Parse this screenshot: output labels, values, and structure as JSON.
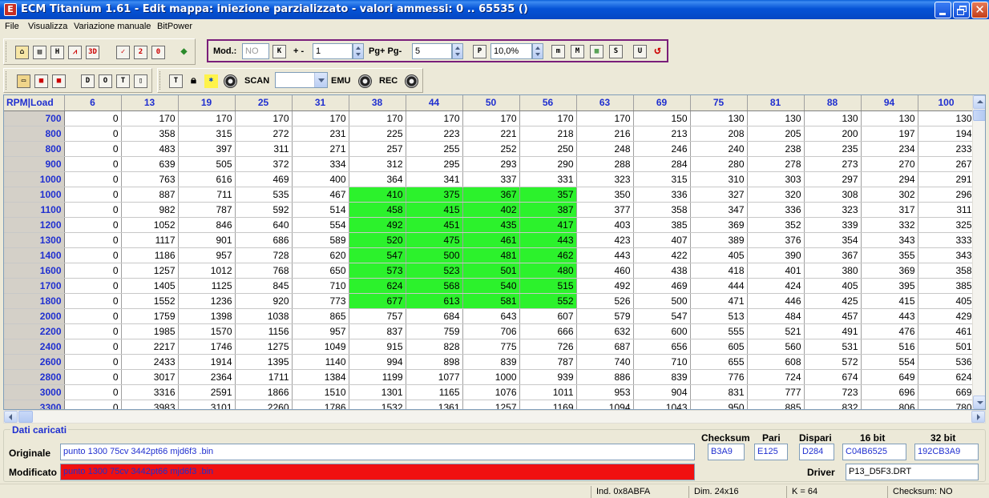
{
  "window": {
    "title": "ECM Titanium 1.61 - Edit mappa: iniezione parzializzato - valori ammessi: 0 .. 65535 ()"
  },
  "menu": [
    "File",
    "Visualizza",
    "Variazione manuale",
    "BitPower"
  ],
  "toolbar": {
    "mod_label": "Mod.:",
    "mod_value": "NO",
    "plusminus_label": "+ -",
    "step_value": "1",
    "page_label": "Pg+ Pg-",
    "page_value": "5",
    "percent_value": "10,0%",
    "scan_label": "SCAN",
    "scan_value": "",
    "emu_label": "EMU",
    "rec_label": "REC"
  },
  "map": {
    "corner": "RPM|Load",
    "columns": [
      "6",
      "13",
      "19",
      "25",
      "31",
      "38",
      "44",
      "50",
      "56",
      "63",
      "69",
      "75",
      "81",
      "88",
      "94",
      "100"
    ],
    "rows": [
      {
        "rpm": "700",
        "values": [
          "0",
          "170",
          "170",
          "170",
          "170",
          "170",
          "170",
          "170",
          "170",
          "170",
          "150",
          "130",
          "130",
          "130",
          "130",
          "130"
        ]
      },
      {
        "rpm": "800",
        "values": [
          "0",
          "358",
          "315",
          "272",
          "231",
          "225",
          "223",
          "221",
          "218",
          "216",
          "213",
          "208",
          "205",
          "200",
          "197",
          "194"
        ]
      },
      {
        "rpm": "800",
        "values": [
          "0",
          "483",
          "397",
          "311",
          "271",
          "257",
          "255",
          "252",
          "250",
          "248",
          "246",
          "240",
          "238",
          "235",
          "234",
          "233"
        ]
      },
      {
        "rpm": "900",
        "values": [
          "0",
          "639",
          "505",
          "372",
          "334",
          "312",
          "295",
          "293",
          "290",
          "288",
          "284",
          "280",
          "278",
          "273",
          "270",
          "267"
        ]
      },
      {
        "rpm": "1000",
        "values": [
          "0",
          "763",
          "616",
          "469",
          "400",
          "364",
          "341",
          "337",
          "331",
          "323",
          "315",
          "310",
          "303",
          "297",
          "294",
          "291"
        ]
      },
      {
        "rpm": "1000",
        "values": [
          "0",
          "887",
          "711",
          "535",
          "467",
          "410",
          "375",
          "367",
          "357",
          "350",
          "336",
          "327",
          "320",
          "308",
          "302",
          "296"
        ]
      },
      {
        "rpm": "1100",
        "values": [
          "0",
          "982",
          "787",
          "592",
          "514",
          "458",
          "415",
          "402",
          "387",
          "377",
          "358",
          "347",
          "336",
          "323",
          "317",
          "311"
        ]
      },
      {
        "rpm": "1200",
        "values": [
          "0",
          "1052",
          "846",
          "640",
          "554",
          "492",
          "451",
          "435",
          "417",
          "403",
          "385",
          "369",
          "352",
          "339",
          "332",
          "325"
        ]
      },
      {
        "rpm": "1300",
        "values": [
          "0",
          "1117",
          "901",
          "686",
          "589",
          "520",
          "475",
          "461",
          "443",
          "423",
          "407",
          "389",
          "376",
          "354",
          "343",
          "333"
        ]
      },
      {
        "rpm": "1400",
        "values": [
          "0",
          "1186",
          "957",
          "728",
          "620",
          "547",
          "500",
          "481",
          "462",
          "443",
          "422",
          "405",
          "390",
          "367",
          "355",
          "343"
        ]
      },
      {
        "rpm": "1600",
        "values": [
          "0",
          "1257",
          "1012",
          "768",
          "650",
          "573",
          "523",
          "501",
          "480",
          "460",
          "438",
          "418",
          "401",
          "380",
          "369",
          "358"
        ]
      },
      {
        "rpm": "1700",
        "values": [
          "0",
          "1405",
          "1125",
          "845",
          "710",
          "624",
          "568",
          "540",
          "515",
          "492",
          "469",
          "444",
          "424",
          "405",
          "395",
          "385"
        ]
      },
      {
        "rpm": "1800",
        "values": [
          "0",
          "1552",
          "1236",
          "920",
          "773",
          "677",
          "613",
          "581",
          "552",
          "526",
          "500",
          "471",
          "446",
          "425",
          "415",
          "405"
        ]
      },
      {
        "rpm": "2000",
        "values": [
          "0",
          "1759",
          "1398",
          "1038",
          "865",
          "757",
          "684",
          "643",
          "607",
          "579",
          "547",
          "513",
          "484",
          "457",
          "443",
          "429"
        ]
      },
      {
        "rpm": "2200",
        "values": [
          "0",
          "1985",
          "1570",
          "1156",
          "957",
          "837",
          "759",
          "706",
          "666",
          "632",
          "600",
          "555",
          "521",
          "491",
          "476",
          "461"
        ]
      },
      {
        "rpm": "2400",
        "values": [
          "0",
          "2217",
          "1746",
          "1275",
          "1049",
          "915",
          "828",
          "775",
          "726",
          "687",
          "656",
          "605",
          "560",
          "531",
          "516",
          "501"
        ]
      },
      {
        "rpm": "2600",
        "values": [
          "0",
          "2433",
          "1914",
          "1395",
          "1140",
          "994",
          "898",
          "839",
          "787",
          "740",
          "710",
          "655",
          "608",
          "572",
          "554",
          "536"
        ]
      },
      {
        "rpm": "2800",
        "values": [
          "0",
          "3017",
          "2364",
          "1711",
          "1384",
          "1199",
          "1077",
          "1000",
          "939",
          "886",
          "839",
          "776",
          "724",
          "674",
          "649",
          "624"
        ]
      },
      {
        "rpm": "3000",
        "values": [
          "0",
          "3316",
          "2591",
          "1866",
          "1510",
          "1301",
          "1165",
          "1076",
          "1011",
          "953",
          "904",
          "831",
          "777",
          "723",
          "696",
          "669"
        ]
      },
      {
        "rpm": "3300",
        "values": [
          "0",
          "3983",
          "3101",
          "2260",
          "1786",
          "1532",
          "1361",
          "1257",
          "1169",
          "1094",
          "1043",
          "950",
          "885",
          "832",
          "806",
          "780"
        ]
      }
    ],
    "highlight": {
      "rows_from": 5,
      "rows_to": 12,
      "cols_from": 5,
      "cols_to": 8,
      "color": "#2CF22C"
    }
  },
  "panel": {
    "title": "Dati caricati",
    "original_label": "Originale",
    "original_file": "punto 1300 75cv 3442pt66 mjd6f3 .bin",
    "modified_label": "Modificato",
    "modified_file": "punto 1300 75cv 3442pt66 mjd6f3 .bin",
    "checksum_label": "Checksum",
    "checksum_value": "B3A9",
    "pari_label": "Pari",
    "pari_value": "E125",
    "dispari_label": "Dispari",
    "dispari_value": "D284",
    "bit16_label": "16 bit",
    "bit16_value": "C04B6525",
    "bit32_label": "32 bit",
    "bit32_value": "192CB3A9",
    "driver_label": "Driver",
    "driver_value": "P13_D5F3.DRT"
  },
  "status": {
    "ind": "Ind. 0x8ABFA",
    "dim": "Dim. 24x16",
    "k": "K = 64",
    "checksum": "Checksum: NO"
  },
  "colors": {
    "title_blue": "#0553D6",
    "header_text": "#1F2FD0",
    "modified_bg": "#F01010",
    "mod_group_border": "#7A1E7A"
  }
}
